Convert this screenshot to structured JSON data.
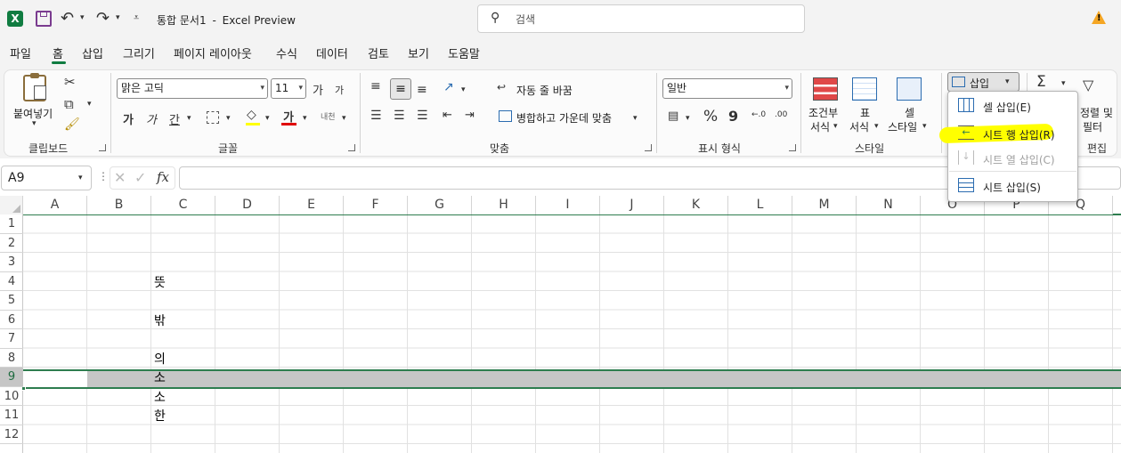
{
  "app": {
    "doc_title": "통합 문서1",
    "title_sep": "-",
    "app_name": "Excel Preview",
    "search_placeholder": "검색"
  },
  "menu_tabs": [
    "파일",
    "홈",
    "삽입",
    "그리기",
    "페이지 레이아웃",
    "수식",
    "데이터",
    "검토",
    "보기",
    "도움말"
  ],
  "active_tab": "홈",
  "ribbon": {
    "clipboard": {
      "paste_label": "붙여넣기",
      "group_label": "클립보드"
    },
    "font": {
      "font_name": "맑은 고딕",
      "font_size": "11",
      "grow": "가",
      "shrink": "가",
      "bold": "가",
      "italic": "가",
      "underline": "간",
      "font_color_glyph": "가",
      "phonetic": "내천",
      "group_label": "글꼴"
    },
    "alignment": {
      "wrap_text": "자동 줄 바꿈",
      "merge_center": "병합하고 가운데 맞춤",
      "group_label": "맞춤"
    },
    "number": {
      "format": "일반",
      "percent": "%",
      "comma": "9",
      "group_label": "표시 형식"
    },
    "styles": {
      "conditional_1": "조건부",
      "conditional_2": "서식",
      "table_1": "표",
      "table_2": "서식",
      "cell_1": "셀",
      "cell_2": "스타일",
      "group_label": "스타일"
    },
    "cells": {
      "insert_label": "삽입"
    },
    "editing": {
      "sigma": "Σ",
      "sort_1": "정렬 및",
      "sort_2": "필터",
      "group_label": "편집"
    }
  },
  "formula_bar": {
    "name_box": "A9",
    "fx": "fx",
    "formula": ""
  },
  "columns": [
    "A",
    "B",
    "C",
    "D",
    "E",
    "F",
    "G",
    "H",
    "I",
    "J",
    "K",
    "L",
    "M",
    "N",
    "O",
    "P",
    "Q"
  ],
  "rows": [
    "1",
    "2",
    "3",
    "4",
    "5",
    "6",
    "7",
    "8",
    "9",
    "10",
    "11",
    "12"
  ],
  "cells": {
    "C4": "뜻",
    "C6": "밖",
    "C8": "의",
    "C9": "소",
    "C10": "소",
    "C11": "한"
  },
  "selected_row": "9",
  "insert_menu": [
    {
      "label": "셀 삽입(E)",
      "enabled": true,
      "highlighted": false
    },
    {
      "label": "시트 행 삽입(R)",
      "enabled": true,
      "highlighted": true
    },
    {
      "label": "시트 열 삽입(C)",
      "enabled": false,
      "highlighted": false
    },
    {
      "label": "시트 삽입(S)",
      "enabled": true,
      "highlighted": false
    }
  ],
  "colors": {
    "accent": "#107c41",
    "highlight": "#ffff00",
    "selected_row": "#c6c6c6"
  }
}
